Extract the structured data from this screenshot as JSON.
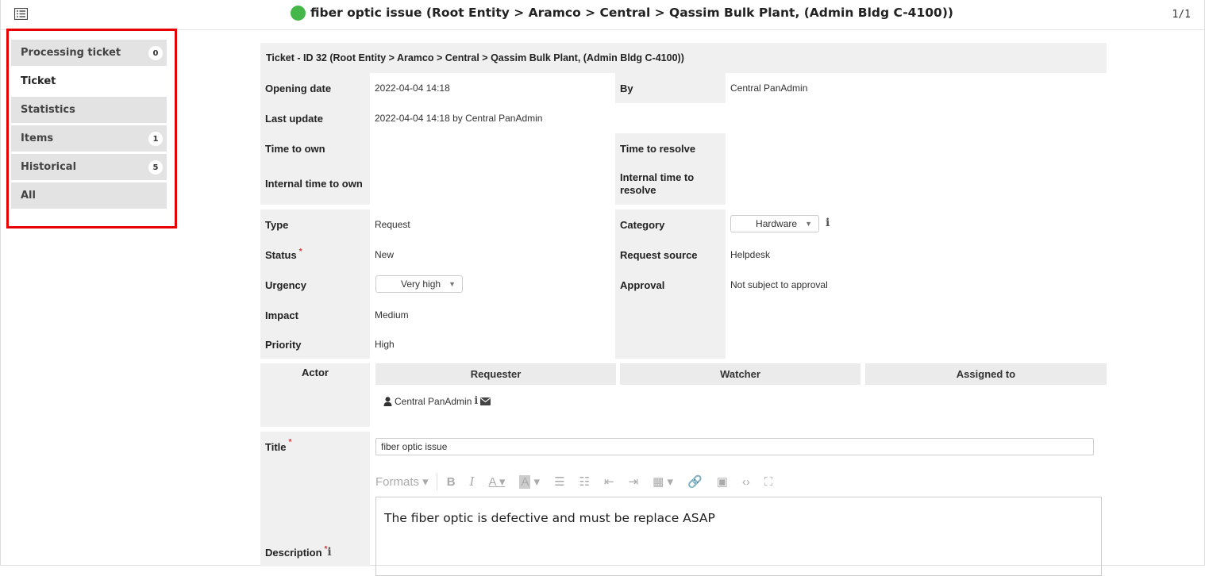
{
  "header": {
    "title": "fiber optic issue (Root Entity > Aramco > Central > Qassim Bulk Plant, (Admin Bldg C-4100))",
    "status_color": "#45b74a",
    "pager": "1/1"
  },
  "sidebar": {
    "tabs": [
      {
        "label": "Processing ticket",
        "badge": "0"
      },
      {
        "label": "Ticket",
        "badge": null
      },
      {
        "label": "Statistics",
        "badge": null
      },
      {
        "label": "Items",
        "badge": "1"
      },
      {
        "label": "Historical",
        "badge": "5"
      },
      {
        "label": "All",
        "badge": null
      }
    ],
    "highlight_color": "#e60000"
  },
  "ticket": {
    "heading": "Ticket - ID 32 (Root Entity > Aramco > Central > Qassim Bulk Plant, (Admin Bldg C-4100))",
    "opening_date_label": "Opening date",
    "opening_date": "2022-04-04 14:18",
    "by_label": "By",
    "by": "Central PanAdmin",
    "last_update_label": "Last update",
    "last_update": "2022-04-04 14:18 by Central PanAdmin",
    "time_to_own_label": "Time to own",
    "time_to_resolve_label": "Time to resolve",
    "internal_time_to_own_label": "Internal time to own",
    "internal_time_to_resolve_label": "Internal time to resolve",
    "type_label": "Type",
    "type": "Request",
    "category_label": "Category",
    "category": "Hardware",
    "status_label": "Status",
    "status": "New",
    "request_source_label": "Request source",
    "request_source": "Helpdesk",
    "urgency_label": "Urgency",
    "urgency": "Very high",
    "approval_label": "Approval",
    "approval": "Not subject to approval",
    "impact_label": "Impact",
    "impact": "Medium",
    "priority_label": "Priority",
    "priority": "High",
    "required_mark": "*"
  },
  "actors": {
    "actor_label": "Actor",
    "requester_label": "Requester",
    "watcher_label": "Watcher",
    "assigned_label": "Assigned to",
    "requester_name": "Central PanAdmin"
  },
  "form": {
    "title_label": "Title",
    "title_value": "fiber optic issue",
    "description_label": "Description",
    "formats_label": "Formats",
    "description_text": "The fiber optic is defective and must be replace ASAP"
  }
}
